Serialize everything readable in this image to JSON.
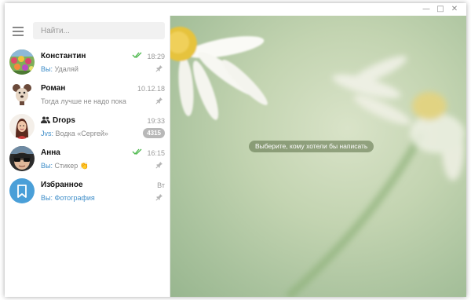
{
  "window": {
    "controls": [
      "minimize",
      "maximize",
      "close"
    ]
  },
  "sidebar": {
    "search": {
      "placeholder": "Найти..."
    },
    "chats": [
      {
        "name": "Константин",
        "time": "18:29",
        "read": true,
        "sender": "Вы:",
        "preview": "Удаляй",
        "pinned": true,
        "avatar": "photo-flowers"
      },
      {
        "name": "Роман",
        "time": "10.12.18",
        "read": false,
        "sender": "",
        "preview": "Тогда лучше не надо пока",
        "pinned": true,
        "avatar": "cartoon-mouse"
      },
      {
        "name": "Drops",
        "group": true,
        "time": "19:33",
        "sender": "Jvs:",
        "preview": "Водка «Сергей»",
        "unread_count": "4315",
        "avatar": "photo-woman"
      },
      {
        "name": "Анна",
        "time": "16:15",
        "read": true,
        "sender": "Вы:",
        "preview": "Стикер 👏",
        "pinned": true,
        "avatar": "photo-sunglasses"
      },
      {
        "name": "Избранное",
        "time": "Вт",
        "sender": "Вы:",
        "preview": "Фотография",
        "pinned": true,
        "avatar": "bookmark-icon"
      }
    ]
  },
  "main": {
    "empty_hint": "Выберите, кому хотели бы написать"
  },
  "colors": {
    "accent": "#3f8ec9",
    "check": "#4db84d",
    "saved_avatar": "#4a9fd8",
    "badge": "#b8b8b8"
  }
}
